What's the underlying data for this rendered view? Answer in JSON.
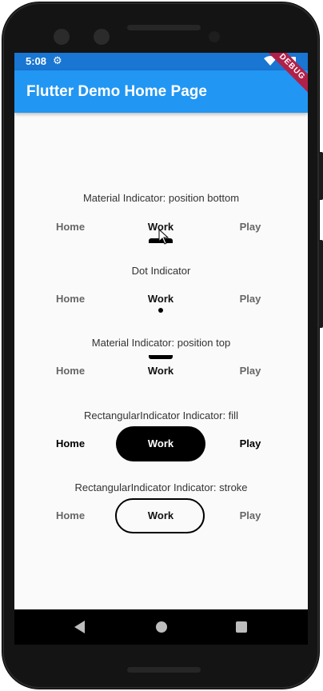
{
  "status_bar": {
    "time": "5:08",
    "settings_icon": "gear-icon",
    "wifi_icon": "wifi-icon",
    "battery_icon": "battery-icon"
  },
  "app_bar": {
    "title": "Flutter Demo Home Page",
    "color": "#2196f3"
  },
  "debug_banner": {
    "label": "DEBUG",
    "color": "#b0214a"
  },
  "sections": [
    {
      "title": "Material Indicator: position bottom",
      "tabs": [
        "Home",
        "Work",
        "Play"
      ],
      "selected": "Work"
    },
    {
      "title": "Dot Indicator",
      "tabs": [
        "Home",
        "Work",
        "Play"
      ],
      "selected": "Work"
    },
    {
      "title": "Material Indicator: position top",
      "tabs": [
        "Home",
        "Work",
        "Play"
      ],
      "selected": "Work"
    },
    {
      "title": "RectangularIndicator Indicator: fill",
      "tabs": [
        "Home",
        "Work",
        "Play"
      ],
      "selected": "Work"
    },
    {
      "title": "RectangularIndicator Indicator: stroke",
      "tabs": [
        "Home",
        "Work",
        "Play"
      ],
      "selected": "Work"
    }
  ],
  "nav_bar": {
    "back_icon": "back-icon",
    "home_icon": "home-icon",
    "recents_icon": "recents-icon"
  }
}
